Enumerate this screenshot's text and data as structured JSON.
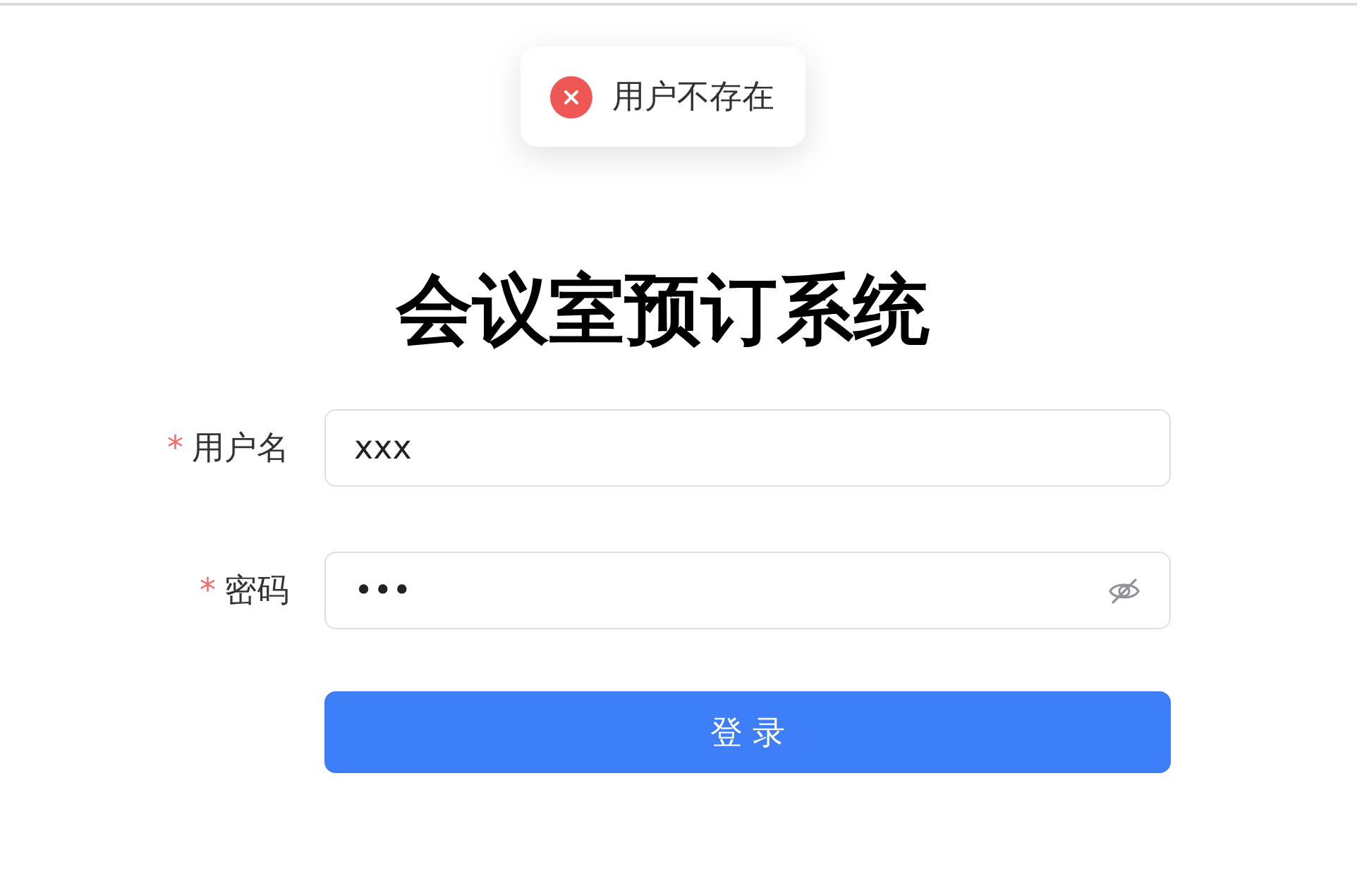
{
  "toast": {
    "kind": "error",
    "message": "用户不存在"
  },
  "title": "会议室预订系统",
  "fields": [
    {
      "label": "用户名",
      "required": true,
      "required_mark": "*",
      "value": "xxx",
      "kind": "text"
    },
    {
      "label": "密码",
      "required": true,
      "required_mark": "*",
      "value": "•••",
      "kind": "password"
    }
  ],
  "submit": {
    "label": "登 录"
  }
}
